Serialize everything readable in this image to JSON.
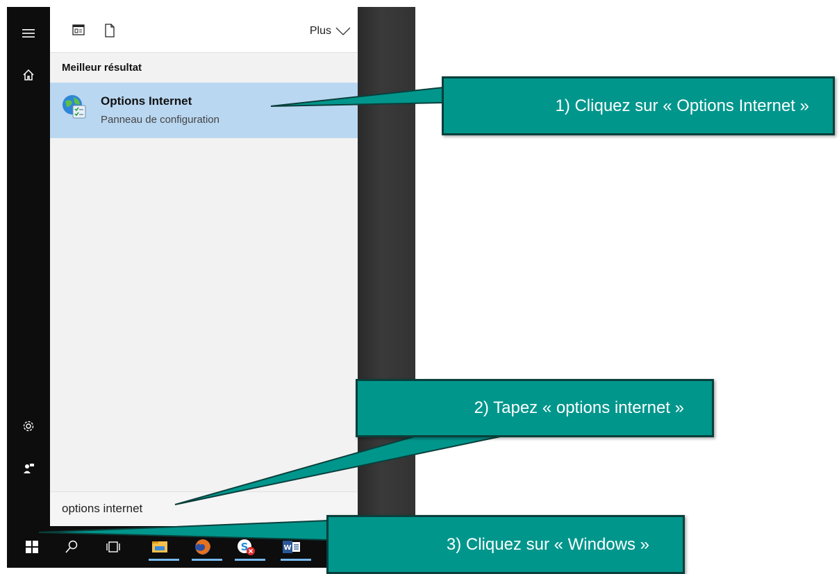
{
  "start_menu": {
    "more_label": "Plus",
    "results_heading": "Meilleur résultat",
    "best_result": {
      "title": "Options Internet",
      "subtitle": "Panneau de configuration",
      "icon": "internet-options-icon"
    },
    "search_query": "options internet"
  },
  "rail_icons": [
    "hamburger-menu-icon",
    "home-icon",
    "settings-gear-icon",
    "user-feedback-icon"
  ],
  "taskbar_icons": [
    "windows-start-icon",
    "search-icon",
    "task-view-icon",
    "file-explorer-icon",
    "firefox-icon",
    "skype-icon",
    "word-icon"
  ],
  "callouts": {
    "step1": "1)   Cliquez sur « Options Internet »",
    "step2": "2)   Tapez « options internet »",
    "step3": "3)   Cliquez sur « Windows »"
  },
  "colors": {
    "callout_fill": "#00968c",
    "callout_border": "#0a3f3b",
    "selection": "#b9d7f1",
    "rail": "#0d0d0d"
  }
}
